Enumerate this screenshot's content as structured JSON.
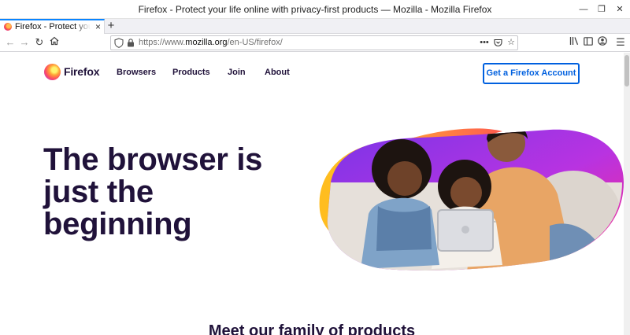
{
  "window": {
    "title": "Firefox - Protect your life online with privacy-first products — Mozilla - Mozilla Firefox"
  },
  "tabs": [
    {
      "label": "Firefox - Protect your life online",
      "active": true
    }
  ],
  "url": {
    "prefix": "https://www.",
    "domain": "mozilla.org",
    "path": "/en-US/firefox/"
  },
  "site": {
    "logo_text": "Firefox",
    "nav": [
      {
        "label": "Browsers"
      },
      {
        "label": "Products"
      },
      {
        "label": "Join"
      },
      {
        "label": "About"
      }
    ],
    "cta_label": "Get a Firefox Account"
  },
  "hero": {
    "headline": "The browser is just the beginning"
  },
  "section": {
    "title": "Meet our family of products"
  },
  "colors": {
    "brand_dark": "#20123a",
    "cta_blue": "#0060df",
    "tab_accent": "#0a84ff"
  }
}
